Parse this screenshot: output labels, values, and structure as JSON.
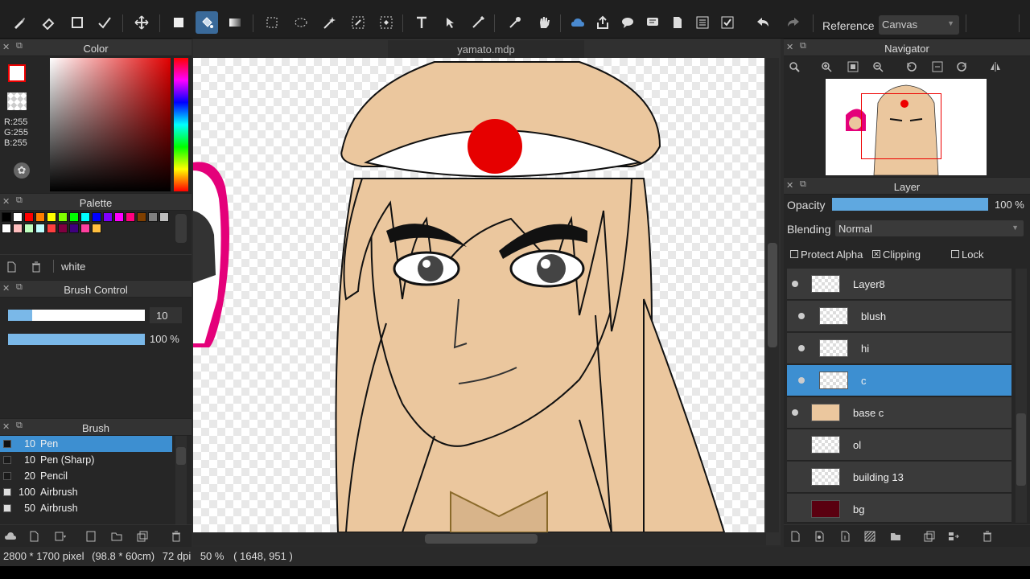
{
  "document": {
    "tab_title": "yamato.mdp"
  },
  "toolbar": {
    "reference_label": "Reference",
    "reference_value": "Canvas"
  },
  "color_panel": {
    "title": "Color",
    "rgb": {
      "r": "R:255",
      "g": "G:255",
      "b": "B:255"
    },
    "foreground": "#ffffff",
    "background": "#ff0000"
  },
  "palette_panel": {
    "title": "Palette",
    "selected_name": "white",
    "swatches": [
      "#000000",
      "#ffffff",
      "#ff0000",
      "#ff7f00",
      "#ffff00",
      "#7fff00",
      "#00ff00",
      "#00ffff",
      "#0000ff",
      "#7f00ff",
      "#ff00ff",
      "#ff007f",
      "#7f3f00",
      "#7f7f7f",
      "#bfbfbf",
      "#ffffff",
      "#ffbfbf",
      "#bfffbf",
      "#bfffff",
      "#ff3f3f",
      "#7f003f",
      "#3f007f",
      "#ff3f9f",
      "#ffbf3f"
    ]
  },
  "brush_control": {
    "title": "Brush Control",
    "size": "10",
    "opacity": "100 %"
  },
  "brush_panel": {
    "title": "Brush",
    "items": [
      {
        "size": "10",
        "name": "Pen"
      },
      {
        "size": "10",
        "name": "Pen (Sharp)"
      },
      {
        "size": "20",
        "name": "Pencil"
      },
      {
        "size": "100",
        "name": "Airbrush"
      },
      {
        "size": "50",
        "name": "Airbrush"
      }
    ]
  },
  "navigator": {
    "title": "Navigator"
  },
  "layer_panel": {
    "title": "Layer",
    "opacity_label": "Opacity",
    "opacity_value": "100 %",
    "blending_label": "Blending",
    "blending_value": "Normal",
    "protect_alpha": "Protect Alpha",
    "clipping": "Clipping",
    "lock": "Lock",
    "layers": [
      {
        "name": "Layer8"
      },
      {
        "name": "blush"
      },
      {
        "name": "hi"
      },
      {
        "name": "c"
      },
      {
        "name": "base c"
      },
      {
        "name": "ol"
      },
      {
        "name": "building 13"
      },
      {
        "name": "bg"
      }
    ]
  },
  "status": {
    "size": "2800 * 1700 pixel",
    "physical": "(98.8 * 60cm)",
    "dpi": "72 dpi",
    "zoom": "50 %",
    "cursor": "( 1648, 951 )"
  }
}
